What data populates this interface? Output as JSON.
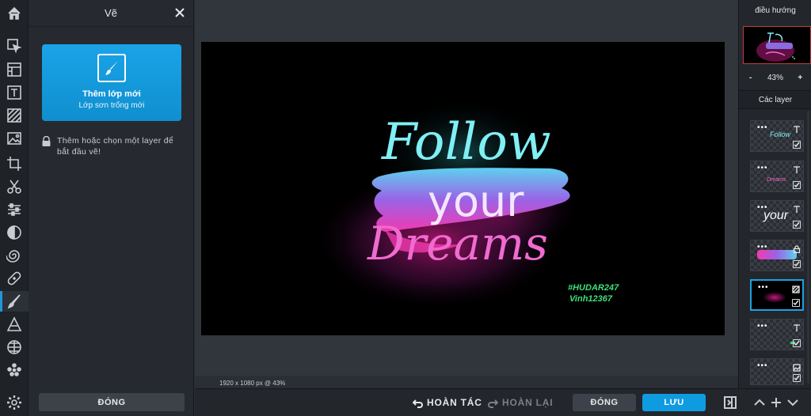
{
  "tools": [
    {
      "name": "home-icon"
    },
    {
      "name": "select-icon"
    },
    {
      "name": "layers-panel-icon"
    },
    {
      "name": "text-icon"
    },
    {
      "name": "pattern-icon"
    },
    {
      "name": "image-icon"
    },
    {
      "name": "crop-icon"
    },
    {
      "name": "cut-icon"
    },
    {
      "name": "adjust-icon"
    },
    {
      "name": "contrast-icon"
    },
    {
      "name": "swirl-icon"
    },
    {
      "name": "bandage-icon"
    },
    {
      "name": "brush-icon"
    },
    {
      "name": "triangle-icon"
    },
    {
      "name": "globe-icon"
    },
    {
      "name": "dots-icon"
    },
    {
      "name": "settings-icon"
    }
  ],
  "panel": {
    "title": "Vẽ",
    "new_layer_title": "Thêm lớp mới",
    "new_layer_subtitle": "Lớp sơn trống mới",
    "hint": "Thêm hoặc chọn một layer để bắt đầu vẽ!",
    "close_label": "ĐÓNG"
  },
  "canvas": {
    "text_follow": "Follow",
    "text_your": "your",
    "text_dreams": "Dreams",
    "tag1": "#HUDAR247",
    "tag2": "Vinh12367",
    "meta": "1920 x 1080 px @ 43%"
  },
  "bottom": {
    "undo": "HOÀN TÁC",
    "redo": "HOÀN LẠI",
    "close": "ĐÓNG",
    "save": "LƯU"
  },
  "right": {
    "navigator_title": "điều hướng",
    "zoom_minus": "-",
    "zoom_value": "43%",
    "zoom_plus": "+",
    "layers_title": "Các layer",
    "layers": [
      {
        "preview": "Follow",
        "kind": "text",
        "dots": "•••"
      },
      {
        "preview": "Dreams",
        "kind": "text",
        "dots": "•••"
      },
      {
        "preview": "your",
        "kind": "text",
        "dots": "•••"
      },
      {
        "preview": "",
        "kind": "image",
        "dots": "•••"
      },
      {
        "preview": "",
        "kind": "pattern",
        "dots": "•••",
        "active": true
      },
      {
        "preview": "",
        "kind": "text",
        "dots": "•••"
      },
      {
        "preview": "",
        "kind": "image",
        "dots": "•••"
      }
    ]
  },
  "colors": {
    "accent": "#1da1e6",
    "follow": "#7ff0f5",
    "dreams": "#f06bd0",
    "tags": "#3ce07a"
  }
}
